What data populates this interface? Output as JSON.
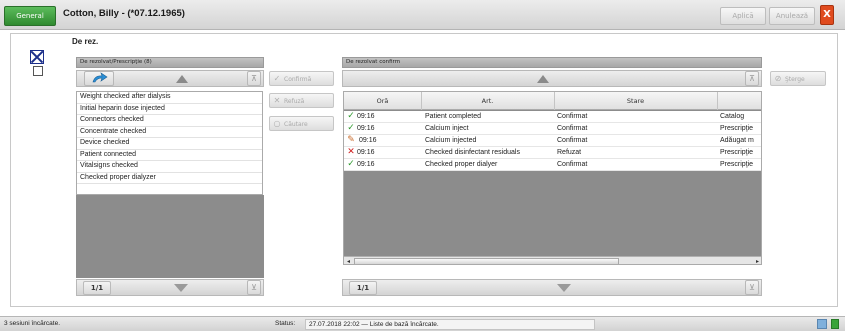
{
  "header": {
    "general_tab": "General",
    "patient_title": "Cotton, Billy - (*07.12.1965)",
    "apply_label": "Aplicā",
    "cancel_label": "Anulează",
    "close_label": "X"
  },
  "section": {
    "title": "De rez."
  },
  "left_panel": {
    "title": "De rezolvat/Prescripţie (8)",
    "items": [
      "Weight checked after dialysis",
      "Initial heparin dose injected",
      "Connectors checked",
      "Concentrate checked",
      "Device checked",
      "Patient connected",
      "Vitalsigns checked",
      "Checked proper dialyzer"
    ],
    "pager": "1/1"
  },
  "actions": {
    "confirm_label": "Confirmă",
    "refuse_label": "Refuză",
    "search_label": "Căutare"
  },
  "right_panel": {
    "title": "De rezolvat confirm",
    "delete_label": "Şterge",
    "columns": [
      "Oră",
      "Art.",
      "Stare",
      ""
    ],
    "rows": [
      {
        "status_icon": "check-icon",
        "time": "09:16",
        "art": "Patient completed",
        "stare": "Confirmat",
        "extra": "Catalog"
      },
      {
        "status_icon": "check-icon",
        "time": "09:16",
        "art": "Calcium inject",
        "stare": "Confirmat",
        "extra": "Prescripţie"
      },
      {
        "status_icon": "pencil-icon",
        "time": "09:16",
        "art": "Calcium injected",
        "stare": "Confirmat",
        "extra": "Adăugat m"
      },
      {
        "status_icon": "cross-icon",
        "time": "09:16",
        "art": "Checked disinfectant residuals",
        "stare": "Refuzat",
        "extra": "Prescripţie"
      },
      {
        "status_icon": "check-icon",
        "time": "09:16",
        "art": "Checked proper dialyer",
        "stare": "Confirmat",
        "extra": "Prescripţie"
      }
    ],
    "pager": "1/1"
  },
  "statusbar": {
    "sessions": "3 sesiuni încărcate.",
    "status_label": "Status:",
    "status_value": "27.07.2018 22:02 — Liste de bază încărcate."
  },
  "colors": {
    "general_green": "#3f9b3f",
    "close_orange": "#e04b1e",
    "check_green": "#2e9a2e",
    "cross_red": "#d01c1c",
    "pencil_orange": "#c86a2a"
  }
}
